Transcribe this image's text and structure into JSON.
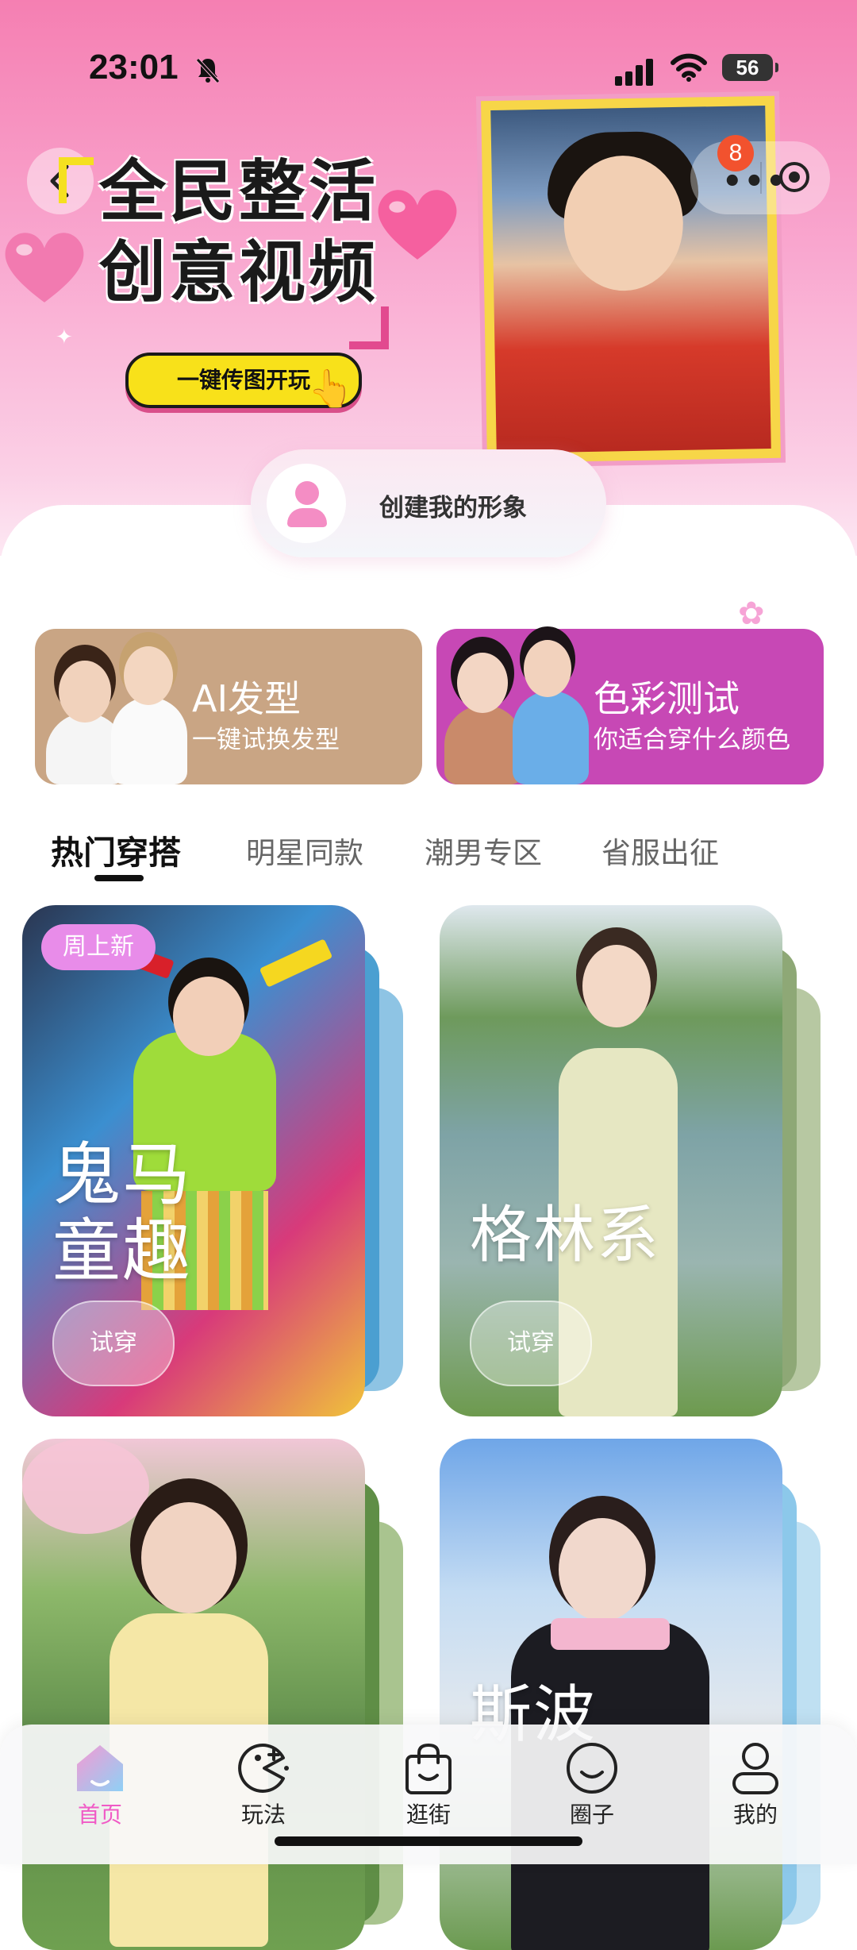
{
  "status_bar": {
    "time": "23:01",
    "battery": "56"
  },
  "banner": {
    "title_line1": "全民整活",
    "title_line2": "创意视频",
    "cta": "一键传图开玩",
    "notification_count": "8"
  },
  "create_avatar": {
    "label": "创建我的形象"
  },
  "features": [
    {
      "title": "AI发型",
      "subtitle": "一键试换发型"
    },
    {
      "title": "色彩测试",
      "subtitle": "你适合穿什么颜色"
    }
  ],
  "tabs": [
    "热门穿搭",
    "明星同款",
    "潮男专区",
    "省服出征"
  ],
  "outfits": [
    {
      "badge": "周上新",
      "name": "鬼马\n童趣",
      "try_label": "试穿"
    },
    {
      "name": "格林系",
      "try_label": "试穿"
    },
    {
      "name": ""
    },
    {
      "name": "斯波"
    }
  ],
  "bottom_nav": [
    {
      "label": "首页",
      "icon": "home-icon"
    },
    {
      "label": "玩法",
      "icon": "pacman-icon"
    },
    {
      "label": "逛街",
      "icon": "shopping-bag-icon"
    },
    {
      "label": "圈子",
      "icon": "smile-icon"
    },
    {
      "label": "我的",
      "icon": "profile-icon"
    }
  ]
}
